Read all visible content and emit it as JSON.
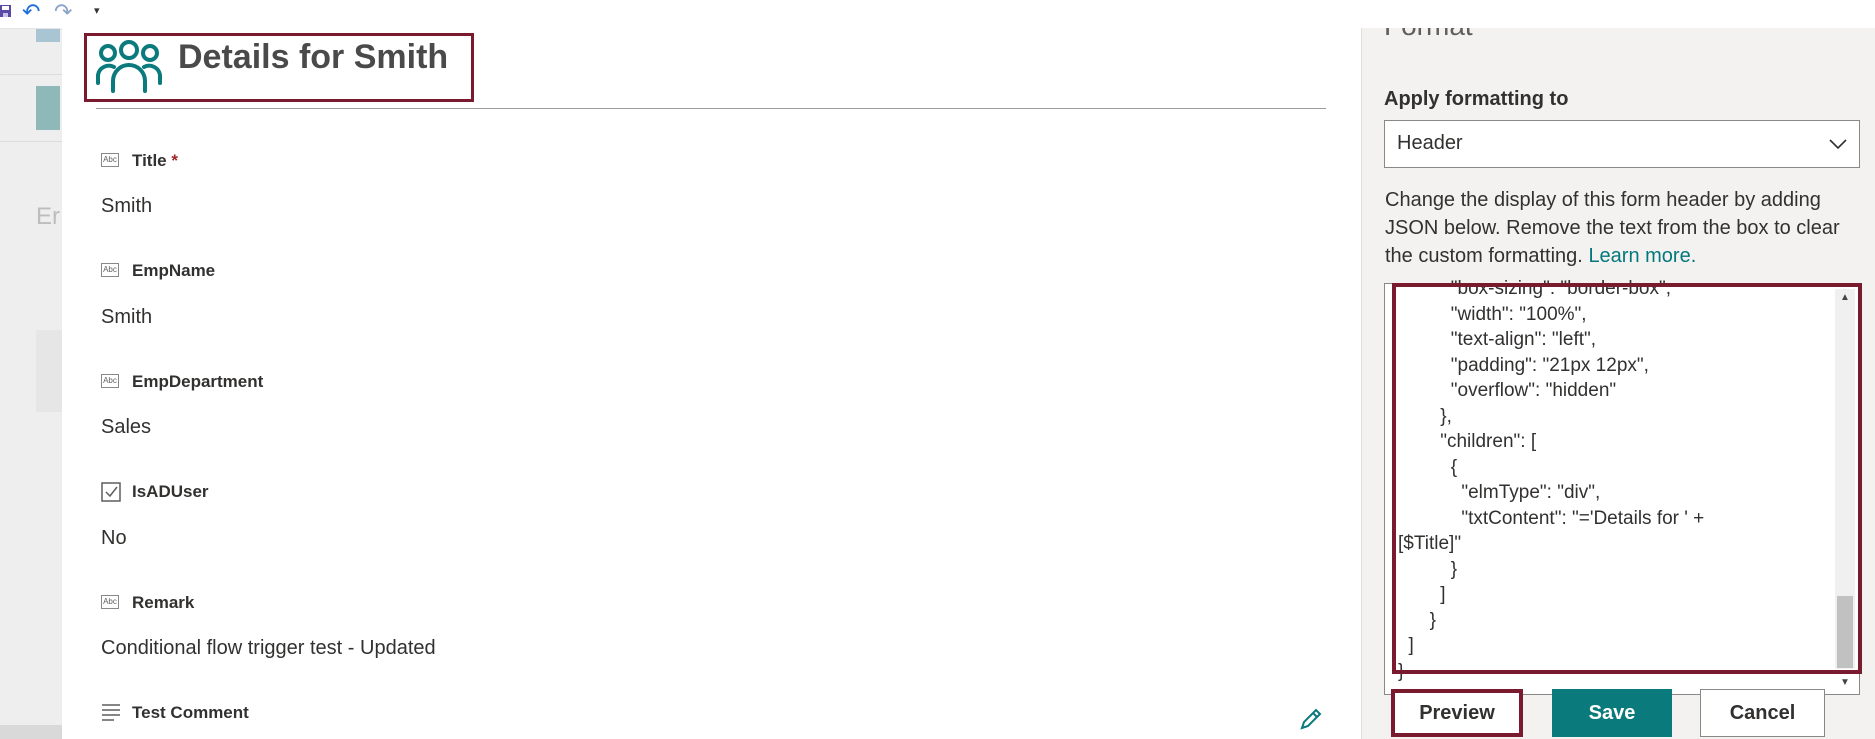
{
  "toolbar": {
    "save_icon": "save-icon",
    "undo_icon": "undo-icon",
    "redo_icon": "redo-icon",
    "more_icon": "customize-toolbar-icon"
  },
  "background": {
    "partial_text": "Er"
  },
  "form": {
    "header_title": "Details for Smith",
    "header_icon": "people-icon",
    "fields": [
      {
        "label": "Title",
        "required_mark": "*",
        "value": "Smith",
        "icon": "text-field-icon"
      },
      {
        "label": "EmpName",
        "value": "Smith",
        "icon": "text-field-icon"
      },
      {
        "label": "EmpDepartment",
        "value": "Sales",
        "icon": "text-field-icon"
      },
      {
        "label": "IsADUser",
        "value": "No",
        "icon": "checkbox-field-icon"
      },
      {
        "label": "Remark",
        "value": "Conditional flow trigger test - Updated",
        "icon": "text-field-icon"
      },
      {
        "label": "Test Comment",
        "icon": "multiline-field-icon"
      }
    ],
    "field_icon_text": "Abc"
  },
  "pane": {
    "heading_partial": "Format",
    "apply_label": "Apply formatting to",
    "dropdown_value": "Header",
    "description": "Change the display of this form header by adding JSON below. Remove the text from the box to clear the custom formatting.",
    "learn_more": "Learn more.",
    "code_lines": [
      "          \"box-sizing\": \"border-box\",",
      "          \"width\": \"100%\",",
      "          \"text-align\": \"left\",",
      "          \"padding\": \"21px 12px\",",
      "          \"overflow\": \"hidden\"",
      "        },",
      "        \"children\": [",
      "          {",
      "            \"elmType\": \"div\",",
      "            \"txtContent\": \"='Details for ' +",
      "[$Title]\"",
      "          }",
      "        ]",
      "      }",
      "  ]",
      "}"
    ],
    "buttons": {
      "preview": "Preview",
      "save": "Save",
      "cancel": "Cancel"
    },
    "accent_color": "#0b7a7d",
    "highlight_color": "#7a1a2e"
  }
}
